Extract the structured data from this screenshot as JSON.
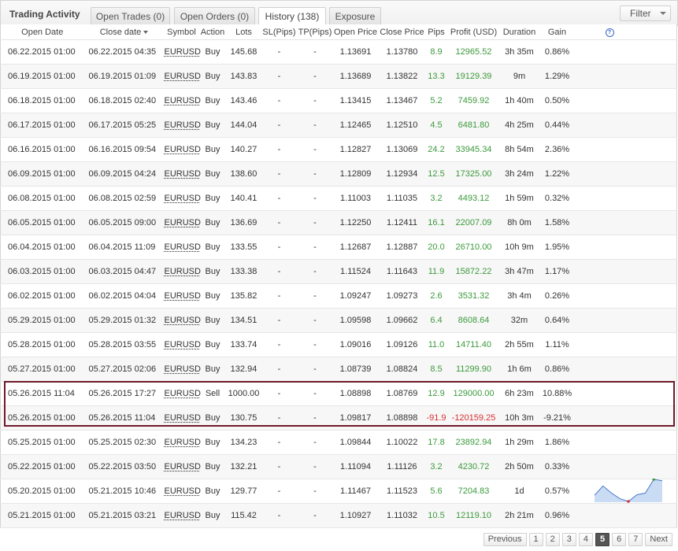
{
  "header": {
    "title": "Trading Activity",
    "tabs": [
      {
        "label": "Open Trades (0)"
      },
      {
        "label": "Open Orders (0)"
      },
      {
        "label": "History (138)"
      },
      {
        "label": "Exposure"
      }
    ],
    "filter_label": "Filter"
  },
  "columns": [
    "Open Date",
    "Close date",
    "Symbol",
    "Action",
    "Lots",
    "SL(Pips)",
    "TP(Pips)",
    "Open Price",
    "Close Price",
    "Pips",
    "Profit (USD)",
    "Duration",
    "Gain"
  ],
  "rows": [
    {
      "open": "06.22.2015 01:00",
      "close": "06.22.2015 04:35",
      "symbol": "EURUSD",
      "action": "Buy",
      "lots": "145.68",
      "sl": "-",
      "tp": "-",
      "open_price": "1.13691",
      "close_price": "1.13780",
      "pips": "8.9",
      "profit": "12965.52",
      "duration": "3h 35m",
      "gain": "0.86%"
    },
    {
      "open": "06.19.2015 01:00",
      "close": "06.19.2015 01:09",
      "symbol": "EURUSD",
      "action": "Buy",
      "lots": "143.83",
      "sl": "-",
      "tp": "-",
      "open_price": "1.13689",
      "close_price": "1.13822",
      "pips": "13.3",
      "profit": "19129.39",
      "duration": "9m",
      "gain": "1.29%"
    },
    {
      "open": "06.18.2015 01:00",
      "close": "06.18.2015 02:40",
      "symbol": "EURUSD",
      "action": "Buy",
      "lots": "143.46",
      "sl": "-",
      "tp": "-",
      "open_price": "1.13415",
      "close_price": "1.13467",
      "pips": "5.2",
      "profit": "7459.92",
      "duration": "1h 40m",
      "gain": "0.50%"
    },
    {
      "open": "06.17.2015 01:00",
      "close": "06.17.2015 05:25",
      "symbol": "EURUSD",
      "action": "Buy",
      "lots": "144.04",
      "sl": "-",
      "tp": "-",
      "open_price": "1.12465",
      "close_price": "1.12510",
      "pips": "4.5",
      "profit": "6481.80",
      "duration": "4h 25m",
      "gain": "0.44%"
    },
    {
      "open": "06.16.2015 01:00",
      "close": "06.16.2015 09:54",
      "symbol": "EURUSD",
      "action": "Buy",
      "lots": "140.27",
      "sl": "-",
      "tp": "-",
      "open_price": "1.12827",
      "close_price": "1.13069",
      "pips": "24.2",
      "profit": "33945.34",
      "duration": "8h 54m",
      "gain": "2.36%"
    },
    {
      "open": "06.09.2015 01:00",
      "close": "06.09.2015 04:24",
      "symbol": "EURUSD",
      "action": "Buy",
      "lots": "138.60",
      "sl": "-",
      "tp": "-",
      "open_price": "1.12809",
      "close_price": "1.12934",
      "pips": "12.5",
      "profit": "17325.00",
      "duration": "3h 24m",
      "gain": "1.22%"
    },
    {
      "open": "06.08.2015 01:00",
      "close": "06.08.2015 02:59",
      "symbol": "EURUSD",
      "action": "Buy",
      "lots": "140.41",
      "sl": "-",
      "tp": "-",
      "open_price": "1.11003",
      "close_price": "1.11035",
      "pips": "3.2",
      "profit": "4493.12",
      "duration": "1h 59m",
      "gain": "0.32%"
    },
    {
      "open": "06.05.2015 01:00",
      "close": "06.05.2015 09:00",
      "symbol": "EURUSD",
      "action": "Buy",
      "lots": "136.69",
      "sl": "-",
      "tp": "-",
      "open_price": "1.12250",
      "close_price": "1.12411",
      "pips": "16.1",
      "profit": "22007.09",
      "duration": "8h 0m",
      "gain": "1.58%"
    },
    {
      "open": "06.04.2015 01:00",
      "close": "06.04.2015 11:09",
      "symbol": "EURUSD",
      "action": "Buy",
      "lots": "133.55",
      "sl": "-",
      "tp": "-",
      "open_price": "1.12687",
      "close_price": "1.12887",
      "pips": "20.0",
      "profit": "26710.00",
      "duration": "10h 9m",
      "gain": "1.95%"
    },
    {
      "open": "06.03.2015 01:00",
      "close": "06.03.2015 04:47",
      "symbol": "EURUSD",
      "action": "Buy",
      "lots": "133.38",
      "sl": "-",
      "tp": "-",
      "open_price": "1.11524",
      "close_price": "1.11643",
      "pips": "11.9",
      "profit": "15872.22",
      "duration": "3h 47m",
      "gain": "1.17%"
    },
    {
      "open": "06.02.2015 01:00",
      "close": "06.02.2015 04:04",
      "symbol": "EURUSD",
      "action": "Buy",
      "lots": "135.82",
      "sl": "-",
      "tp": "-",
      "open_price": "1.09247",
      "close_price": "1.09273",
      "pips": "2.6",
      "profit": "3531.32",
      "duration": "3h 4m",
      "gain": "0.26%"
    },
    {
      "open": "05.29.2015 01:00",
      "close": "05.29.2015 01:32",
      "symbol": "EURUSD",
      "action": "Buy",
      "lots": "134.51",
      "sl": "-",
      "tp": "-",
      "open_price": "1.09598",
      "close_price": "1.09662",
      "pips": "6.4",
      "profit": "8608.64",
      "duration": "32m",
      "gain": "0.64%"
    },
    {
      "open": "05.28.2015 01:00",
      "close": "05.28.2015 03:55",
      "symbol": "EURUSD",
      "action": "Buy",
      "lots": "133.74",
      "sl": "-",
      "tp": "-",
      "open_price": "1.09016",
      "close_price": "1.09126",
      "pips": "11.0",
      "profit": "14711.40",
      "duration": "2h 55m",
      "gain": "1.11%"
    },
    {
      "open": "05.27.2015 01:00",
      "close": "05.27.2015 02:06",
      "symbol": "EURUSD",
      "action": "Buy",
      "lots": "132.94",
      "sl": "-",
      "tp": "-",
      "open_price": "1.08739",
      "close_price": "1.08824",
      "pips": "8.5",
      "profit": "11299.90",
      "duration": "1h 6m",
      "gain": "0.86%"
    },
    {
      "open": "05.26.2015 11:04",
      "close": "05.26.2015 17:27",
      "symbol": "EURUSD",
      "action": "Sell",
      "lots": "1000.00",
      "sl": "-",
      "tp": "-",
      "open_price": "1.08898",
      "close_price": "1.08769",
      "pips": "12.9",
      "profit": "129000.00",
      "duration": "6h 23m",
      "gain": "10.88%"
    },
    {
      "open": "05.26.2015 01:00",
      "close": "05.26.2015 11:04",
      "symbol": "EURUSD",
      "action": "Buy",
      "lots": "130.75",
      "sl": "-",
      "tp": "-",
      "open_price": "1.09817",
      "close_price": "1.08898",
      "pips": "-91.9",
      "profit": "-120159.25",
      "duration": "10h 3m",
      "gain": "-9.21%"
    },
    {
      "open": "05.25.2015 01:00",
      "close": "05.25.2015 02:30",
      "symbol": "EURUSD",
      "action": "Buy",
      "lots": "134.23",
      "sl": "-",
      "tp": "-",
      "open_price": "1.09844",
      "close_price": "1.10022",
      "pips": "17.8",
      "profit": "23892.94",
      "duration": "1h 29m",
      "gain": "1.86%"
    },
    {
      "open": "05.22.2015 01:00",
      "close": "05.22.2015 03:50",
      "symbol": "EURUSD",
      "action": "Buy",
      "lots": "132.21",
      "sl": "-",
      "tp": "-",
      "open_price": "1.11094",
      "close_price": "1.11126",
      "pips": "3.2",
      "profit": "4230.72",
      "duration": "2h 50m",
      "gain": "0.33%"
    },
    {
      "open": "05.20.2015 01:00",
      "close": "05.21.2015 10:46",
      "symbol": "EURUSD",
      "action": "Buy",
      "lots": "129.77",
      "sl": "-",
      "tp": "-",
      "open_price": "1.11467",
      "close_price": "1.11523",
      "pips": "5.6",
      "profit": "7204.83",
      "duration": "1d",
      "gain": "0.57%"
    },
    {
      "open": "05.21.2015 01:00",
      "close": "05.21.2015 03:21",
      "symbol": "EURUSD",
      "action": "Buy",
      "lots": "115.42",
      "sl": "-",
      "tp": "-",
      "open_price": "1.10927",
      "close_price": "1.11032",
      "pips": "10.5",
      "profit": "12119.10",
      "duration": "2h 21m",
      "gain": "0.96%"
    }
  ],
  "sparkline_values": [
    0.72,
    0.3,
    0.62,
    0.88,
    1.0,
    0.7,
    0.62,
    0.0,
    0.06
  ],
  "pagination": {
    "previous": "Previous",
    "pages": [
      "1",
      "2",
      "3",
      "4",
      "5",
      "6",
      "7"
    ],
    "current": "5",
    "next": "Next"
  },
  "colors": {
    "positive": "#3c9a3c",
    "negative": "#d83030",
    "highlight_border": "#6e1a2a",
    "sparkline_line": "#4a78c8",
    "sparkline_fill": "#c9dcf4"
  }
}
